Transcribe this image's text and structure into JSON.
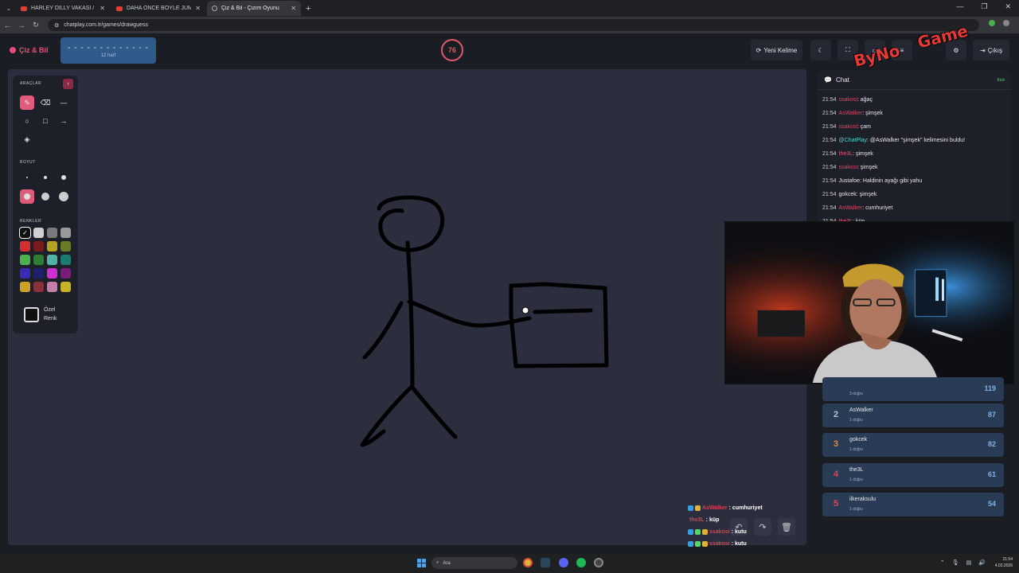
{
  "browser": {
    "tabs": [
      {
        "title": "HARLEY DILLY VAKASI / DEDEK",
        "type": "youtube"
      },
      {
        "title": "DAHA ÖNCE BÖYLE JUMPSCARE",
        "type": "youtube"
      },
      {
        "title": "Çiz & Bil - Çizim Oyunu",
        "type": "globe",
        "active": true
      }
    ],
    "url": "chatplay.com.tr/games/drawguess"
  },
  "app": {
    "logo": "Çiz & Bil",
    "word_mask": "- - - - - - - - - - - - -",
    "word_hint": "12 harf",
    "timer": "76",
    "new_word_label": "Yeni Kelime",
    "logout_label": "Çıkış",
    "brand_text": [
      "ByNo",
      "Game"
    ]
  },
  "tools": {
    "tools_title": "ARAÇLAR",
    "size_title": "BOYUT",
    "colors_title": "RENKLER",
    "custom_color_label_1": "Özel",
    "custom_color_label_2": "Renk",
    "palette": [
      "#111111",
      "#cfcfcf",
      "#7a7a7a",
      "#9a9a9a",
      "#d32f2f",
      "#7a1c1c",
      "#b5a41f",
      "#6b7a24",
      "#4caf50",
      "#2e7d32",
      "#4fb3a8",
      "#1d7a70",
      "#3a2bb5",
      "#1f1f70",
      "#d12fd1",
      "#7a1c7a",
      "#c9a227",
      "#8b2f3a",
      "#c47fa8",
      "#c9b227"
    ]
  },
  "chat": {
    "title": "Chat",
    "platform": "Kick",
    "messages": [
      {
        "time": "21:54",
        "user": "ssakosi",
        "text": ": ağaç",
        "color": "red"
      },
      {
        "time": "21:54",
        "user": "AsWalker",
        "text": ": şimşek",
        "color": "red"
      },
      {
        "time": "21:54",
        "user": "ssakosi",
        "text": ": çam",
        "color": "red"
      },
      {
        "time": "21:54",
        "user": "@ChatPlay",
        "text": ": @AsWalker \"şimşek\" kelimesini buldu!",
        "color": "cp"
      },
      {
        "time": "21:54",
        "user": "the3L",
        "text": ": şimşek",
        "color": "pink"
      },
      {
        "time": "21:54",
        "user": "ssakosi",
        "text": ": şimşek",
        "color": "red"
      },
      {
        "time": "21:54",
        "user": "Justafoe",
        "text": ": Haldinin ayağı gibi yahu",
        "color": "white"
      },
      {
        "time": "21:54",
        "user": "gokcek",
        "text": ": şimşek",
        "color": "white"
      },
      {
        "time": "21:54",
        "user": "AsWalker",
        "text": ": cumhuriyet",
        "color": "red"
      },
      {
        "time": "21:54",
        "user": "the3L",
        "text": ": küp",
        "color": "pink"
      }
    ]
  },
  "leaderboard": [
    {
      "rank": "",
      "name": "",
      "sub": "3 doğru",
      "score": "119",
      "rank_color": "#d8b13a"
    },
    {
      "rank": "2",
      "name": "AsWalker",
      "sub": "1 doğru",
      "score": "87",
      "rank_color": "#b9c4d2"
    },
    {
      "rank": "3",
      "name": "gokcek",
      "sub": "1 doğru",
      "score": "82",
      "rank_color": "#d88a3a"
    },
    {
      "rank": "4",
      "name": "the3L",
      "sub": "1 doğru",
      "score": "61",
      "rank_color": "#e0425d"
    },
    {
      "rank": "5",
      "name": "ilkeraksulu",
      "sub": "1 doğru",
      "score": "54",
      "rank_color": "#e0425d"
    }
  ],
  "overlay_chat": [
    {
      "user": "AsWalker",
      "text": ": cumhuriyet"
    },
    {
      "user": "the3L",
      "text": ": küp"
    },
    {
      "user": "ssakosi",
      "text": ": kutu"
    },
    {
      "user": "ssakosi",
      "text": ": kutu"
    }
  ],
  "taskbar": {
    "search_placeholder": "Ara",
    "time": "21:54",
    "date": "4.02.2026"
  }
}
